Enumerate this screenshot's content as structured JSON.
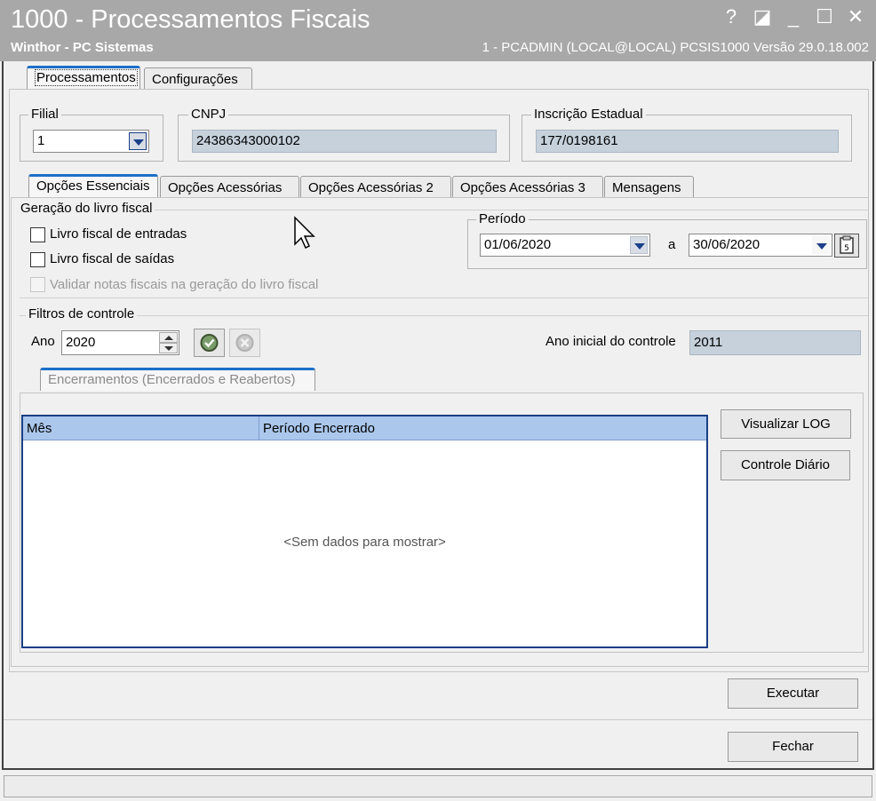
{
  "window": {
    "title": "1000 - Processamentos Fiscais",
    "subtitle": "Winthor - PC Sistemas",
    "session_info": "1 - PCADMIN (LOCAL@LOCAL)   PCSIS1000  Versão  29.0.18.002",
    "controls": [
      "?",
      "◪",
      "_",
      "☐",
      "✕"
    ]
  },
  "main_tabs": [
    {
      "label": "Processamentos",
      "active": true
    },
    {
      "label": "Configurações",
      "active": false
    }
  ],
  "header": {
    "filial_label": "Filial",
    "filial_value": "1",
    "cnpj_label": "CNPJ",
    "cnpj_value": "24386343000102",
    "ie_label": "Inscrição Estadual",
    "ie_value": "177/0198161"
  },
  "sub_tabs": [
    {
      "label": "Opções Essenciais",
      "active": true
    },
    {
      "label": "Opções Acessórias",
      "active": false
    },
    {
      "label": "Opções Acessórias 2",
      "active": false
    },
    {
      "label": "Opções Acessórias 3",
      "active": false
    },
    {
      "label": "Mensagens",
      "active": false
    }
  ],
  "livro": {
    "group_label": "Geração do livro fiscal",
    "entradas_label": "Livro fiscal de entradas",
    "entradas_checked": false,
    "saidas_label": "Livro fiscal de saídas",
    "saidas_checked": false,
    "validar_label": "Validar notas fiscais na geração do livro fiscal",
    "validar_enabled": false
  },
  "periodo": {
    "group_label": "Período",
    "start": "01/06/2020",
    "separator": "a",
    "end": "30/06/2020"
  },
  "filtros": {
    "group_label": "Filtros de controle",
    "ano_label": "Ano",
    "ano_value": "2020",
    "ano_inicial_label": "Ano inicial do controle",
    "ano_inicial_value": "2011"
  },
  "encerramentos": {
    "tab_label": "Encerramentos (Encerrados e Reabertos)",
    "columns": [
      "Mês",
      "Período Encerrado"
    ],
    "empty_message": "<Sem dados para mostrar>",
    "btn_log": "Visualizar LOG",
    "btn_controle": "Controle Diário"
  },
  "actions": {
    "executar": "Executar",
    "fechar": "Fechar"
  }
}
